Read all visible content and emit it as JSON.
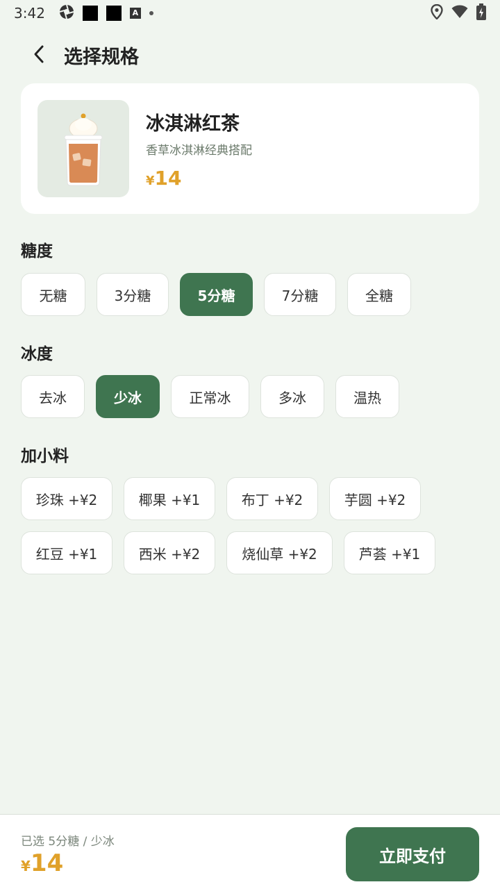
{
  "status_bar": {
    "time": "3:42"
  },
  "header": {
    "title": "选择规格"
  },
  "product": {
    "name": "冰淇淋红茶",
    "description": "香草冰淇淋经典搭配",
    "price_symbol": "¥",
    "price": "14"
  },
  "sugar": {
    "title": "糖度",
    "options": [
      "无糖",
      "3分糖",
      "5分糖",
      "7分糖",
      "全糖"
    ],
    "selected": "5分糖"
  },
  "ice": {
    "title": "冰度",
    "options": [
      "去冰",
      "少冰",
      "正常冰",
      "多冰",
      "温热"
    ],
    "selected": "少冰"
  },
  "toppings": {
    "title": "加小料",
    "options": [
      "珍珠 +¥2",
      "椰果 +¥1",
      "布丁 +¥2",
      "芋圆 +¥2",
      "红豆 +¥1",
      "西米 +¥2",
      "烧仙草 +¥2",
      "芦荟 +¥1"
    ]
  },
  "bottom": {
    "summary": "已选 5分糖 / 少冰",
    "price_symbol": "¥",
    "price": "14",
    "pay_label": "立即支付"
  },
  "colors": {
    "accent": "#3f7550",
    "price": "#e0a12a",
    "background": "#f0f5ef"
  }
}
